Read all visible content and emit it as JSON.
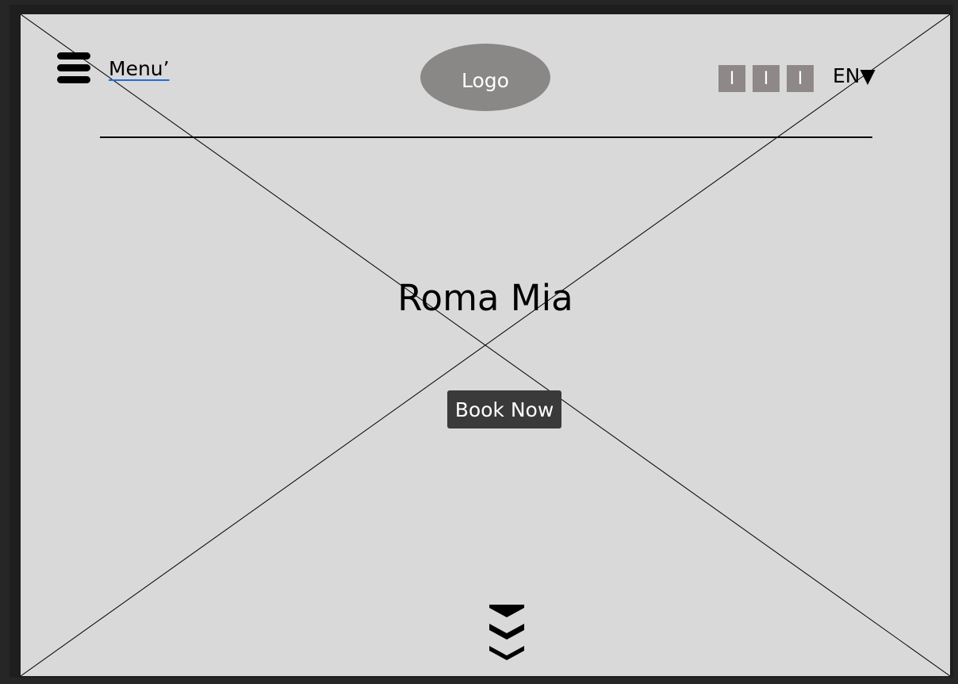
{
  "header": {
    "menu_label": "Menu’",
    "logo_text": "Logo",
    "social_icons": [
      "I",
      "I",
      "I"
    ],
    "language": "EN▼"
  },
  "hero": {
    "title": "Roma Mia",
    "cta_label": "Book Now"
  },
  "icons": {
    "menu": "hamburger-icon",
    "scroll": "chevron-double-down-icon"
  },
  "colors": {
    "canvas": "#d9d9d9",
    "logo_bg": "#8a8787",
    "button_bg": "#3a3a3a",
    "link_underline": "#1e6fd9"
  }
}
